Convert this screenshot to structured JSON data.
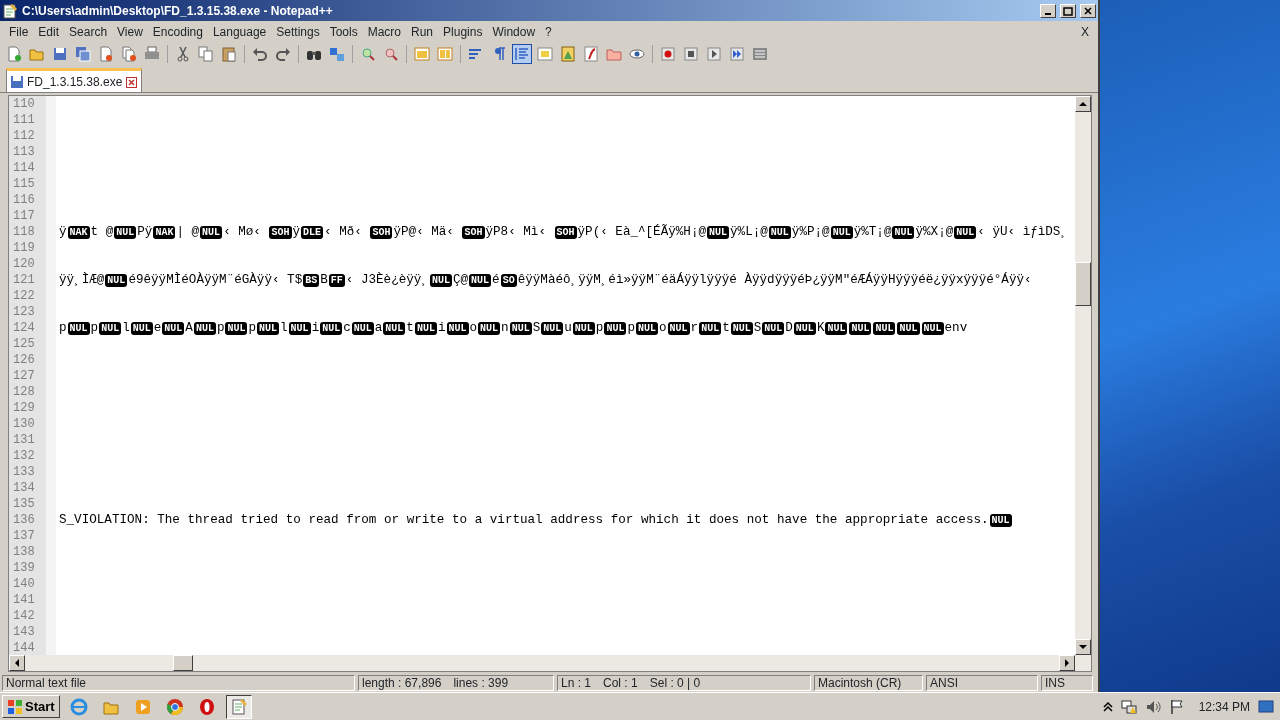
{
  "window": {
    "title": "C:\\Users\\admin\\Desktop\\FD_1.3.15.38.exe - Notepad++",
    "doc_close": "X"
  },
  "menu": [
    "File",
    "Edit",
    "Search",
    "View",
    "Encoding",
    "Language",
    "Settings",
    "Tools",
    "Macro",
    "Run",
    "Plugins",
    "Window",
    "?"
  ],
  "toolbar": [
    [
      {
        "kind": "new",
        "pressed": false
      },
      {
        "kind": "open",
        "pressed": false
      },
      {
        "kind": "save",
        "pressed": false
      },
      {
        "kind": "save-all",
        "pressed": false
      },
      {
        "kind": "close",
        "pressed": false
      },
      {
        "kind": "close-all",
        "pressed": false
      },
      {
        "kind": "print",
        "pressed": false
      }
    ],
    [
      {
        "kind": "cut",
        "pressed": false
      },
      {
        "kind": "copy",
        "pressed": false
      },
      {
        "kind": "paste",
        "pressed": false
      }
    ],
    [
      {
        "kind": "undo",
        "pressed": false
      },
      {
        "kind": "redo",
        "pressed": false
      }
    ],
    [
      {
        "kind": "find",
        "pressed": false
      },
      {
        "kind": "replace",
        "pressed": false
      }
    ],
    [
      {
        "kind": "zoom-in",
        "pressed": false
      },
      {
        "kind": "zoom-out",
        "pressed": false
      }
    ],
    [
      {
        "kind": "sync-v",
        "pressed": false
      },
      {
        "kind": "sync-h",
        "pressed": false
      }
    ],
    [
      {
        "kind": "wrap",
        "pressed": false
      },
      {
        "kind": "pilcrow",
        "pressed": false
      },
      {
        "kind": "indent",
        "pressed": true
      },
      {
        "kind": "lang",
        "pressed": false
      },
      {
        "kind": "docmap",
        "pressed": false
      },
      {
        "kind": "funclist",
        "pressed": false
      },
      {
        "kind": "folder",
        "pressed": false
      },
      {
        "kind": "eye",
        "pressed": false
      }
    ],
    [
      {
        "kind": "record",
        "pressed": false
      },
      {
        "kind": "stop",
        "pressed": false
      },
      {
        "kind": "play",
        "pressed": false
      },
      {
        "kind": "play-multi",
        "pressed": false
      },
      {
        "kind": "save-macro",
        "pressed": false
      }
    ]
  ],
  "tabs": [
    {
      "label": "FD_1.3.15.38.exe",
      "selected": true
    }
  ],
  "editor": {
    "lines": [
      {
        "number": "110"
      },
      {
        "number": "111"
      },
      {
        "number": "112"
      },
      {
        "number": "113"
      },
      {
        "number": "114"
      },
      {
        "number": "115"
      },
      {
        "number": "116"
      },
      {
        "number": "117"
      },
      {
        "number": "118",
        "segments": [
          {
            "kind": "text",
            "text": "ÿ"
          },
          {
            "kind": "ctrl",
            "text": "NAK"
          },
          {
            "kind": "text",
            "text": "t @"
          },
          {
            "kind": "ctrl",
            "text": "NUL"
          },
          {
            "kind": "text",
            "text": "Pÿ"
          },
          {
            "kind": "ctrl",
            "text": "NAK"
          },
          {
            "kind": "text",
            "text": "| @"
          },
          {
            "kind": "ctrl",
            "text": "NUL"
          },
          {
            "kind": "text",
            "text": "‹ Mø‹ "
          },
          {
            "kind": "ctrl",
            "text": "SOH"
          },
          {
            "kind": "text",
            "text": "ÿ"
          },
          {
            "kind": "ctrl",
            "text": "DLE"
          },
          {
            "kind": "text",
            "text": "‹ Mð‹ "
          },
          {
            "kind": "ctrl",
            "text": "SOH"
          },
          {
            "kind": "text",
            "text": "ÿP@‹ Mä‹ "
          },
          {
            "kind": "ctrl",
            "text": "SOH"
          },
          {
            "kind": "text",
            "text": "ÿP8‹ Mì‹ "
          },
          {
            "kind": "ctrl",
            "text": "SOH"
          },
          {
            "kind": "text",
            "text": "ÿP(‹ Eà_^[ÉÃÿ%H¡@"
          },
          {
            "kind": "ctrl",
            "text": "NUL"
          },
          {
            "kind": "text",
            "text": "ÿ%L¡@"
          },
          {
            "kind": "ctrl",
            "text": "NUL"
          },
          {
            "kind": "text",
            "text": "ÿ%P¡@"
          },
          {
            "kind": "ctrl",
            "text": "NUL"
          },
          {
            "kind": "text",
            "text": "ÿ%T¡@"
          },
          {
            "kind": "ctrl",
            "text": "NUL"
          },
          {
            "kind": "text",
            "text": "ÿ%X¡@"
          },
          {
            "kind": "ctrl",
            "text": "NUL"
          },
          {
            "kind": "text",
            "text": "‹ ÿU‹ ìƒìDS¸"
          }
        ]
      },
      {
        "number": "119"
      },
      {
        "number": "120"
      },
      {
        "number": "121",
        "segments": [
          {
            "kind": "text",
            "text": "ÿÿ¸ÌÆ@"
          },
          {
            "kind": "ctrl",
            "text": "NUL"
          },
          {
            "kind": "text",
            "text": "é9êÿÿMÌéOÀÿÿM¨éGÀÿÿ‹ T$"
          },
          {
            "kind": "ctrl",
            "text": "BS"
          },
          {
            "kind": "text",
            "text": "B"
          },
          {
            "kind": "ctrl",
            "text": "FF"
          },
          {
            "kind": "text",
            "text": "‹ J3Èè¿èÿÿ¸"
          },
          {
            "kind": "ctrl",
            "text": "NUL"
          },
          {
            "kind": "text",
            "text": "Ç@"
          },
          {
            "kind": "ctrl",
            "text": "NUL"
          },
          {
            "kind": "text",
            "text": "é"
          },
          {
            "kind": "ctrl",
            "text": "SO"
          },
          {
            "kind": "text",
            "text": "êÿÿMàéô¸ÿÿM¸éì»ÿÿM¨éäÁÿÿlÿÿÿé ÀÿÿdÿÿÿéÞ¿ÿÿM″éÆÁÿÿHÿÿÿéë¿ÿÿxÿÿÿé°Áÿÿ‹"
          }
        ]
      },
      {
        "number": "122"
      },
      {
        "number": "123"
      },
      {
        "number": "124",
        "segments": [
          {
            "kind": "text",
            "text": "p"
          },
          {
            "kind": "ctrl",
            "text": "NUL"
          },
          {
            "kind": "text",
            "text": "p"
          },
          {
            "kind": "ctrl",
            "text": "NUL"
          },
          {
            "kind": "text",
            "text": "l"
          },
          {
            "kind": "ctrl",
            "text": "NUL"
          },
          {
            "kind": "text",
            "text": "e"
          },
          {
            "kind": "ctrl",
            "text": "NUL"
          },
          {
            "kind": "text",
            "text": "A"
          },
          {
            "kind": "ctrl",
            "text": "NUL"
          },
          {
            "kind": "text",
            "text": "p"
          },
          {
            "kind": "ctrl",
            "text": "NUL"
          },
          {
            "kind": "text",
            "text": "p"
          },
          {
            "kind": "ctrl",
            "text": "NUL"
          },
          {
            "kind": "text",
            "text": "l"
          },
          {
            "kind": "ctrl",
            "text": "NUL"
          },
          {
            "kind": "text",
            "text": "i"
          },
          {
            "kind": "ctrl",
            "text": "NUL"
          },
          {
            "kind": "text",
            "text": "c"
          },
          {
            "kind": "ctrl",
            "text": "NUL"
          },
          {
            "kind": "text",
            "text": "a"
          },
          {
            "kind": "ctrl",
            "text": "NUL"
          },
          {
            "kind": "text",
            "text": "t"
          },
          {
            "kind": "ctrl",
            "text": "NUL"
          },
          {
            "kind": "text",
            "text": "i"
          },
          {
            "kind": "ctrl",
            "text": "NUL"
          },
          {
            "kind": "text",
            "text": "o"
          },
          {
            "kind": "ctrl",
            "text": "NUL"
          },
          {
            "kind": "text",
            "text": "n"
          },
          {
            "kind": "ctrl",
            "text": "NUL"
          },
          {
            "kind": "text",
            "text": "S"
          },
          {
            "kind": "ctrl",
            "text": "NUL"
          },
          {
            "kind": "text",
            "text": "u"
          },
          {
            "kind": "ctrl",
            "text": "NUL"
          },
          {
            "kind": "text",
            "text": "p"
          },
          {
            "kind": "ctrl",
            "text": "NUL"
          },
          {
            "kind": "text",
            "text": "p"
          },
          {
            "kind": "ctrl",
            "text": "NUL"
          },
          {
            "kind": "text",
            "text": "o"
          },
          {
            "kind": "ctrl",
            "text": "NUL"
          },
          {
            "kind": "text",
            "text": "r"
          },
          {
            "kind": "ctrl",
            "text": "NUL"
          },
          {
            "kind": "text",
            "text": "t"
          },
          {
            "kind": "ctrl",
            "text": "NUL"
          },
          {
            "kind": "text",
            "text": "S"
          },
          {
            "kind": "ctrl",
            "text": "NUL"
          },
          {
            "kind": "text",
            "text": "D"
          },
          {
            "kind": "ctrl",
            "text": "NUL"
          },
          {
            "kind": "text",
            "text": "K"
          },
          {
            "kind": "ctrl",
            "text": "NUL"
          },
          {
            "kind": "ctrl",
            "text": "NUL"
          },
          {
            "kind": "ctrl",
            "text": "NUL"
          },
          {
            "kind": "ctrl",
            "text": "NUL"
          },
          {
            "kind": "ctrl",
            "text": "NUL"
          },
          {
            "kind": "text",
            "text": "env"
          }
        ]
      },
      {
        "number": "125"
      },
      {
        "number": "126"
      },
      {
        "number": "127"
      },
      {
        "number": "128"
      },
      {
        "number": "129"
      },
      {
        "number": "130"
      },
      {
        "number": "131"
      },
      {
        "number": "132"
      },
      {
        "number": "133"
      },
      {
        "number": "134"
      },
      {
        "number": "135"
      },
      {
        "number": "136",
        "segments": [
          {
            "kind": "text",
            "text": "S_VIOLATION: The thread tried to read from or write to a virtual address for which it does not have the appropriate access."
          },
          {
            "kind": "ctrl",
            "text": "NUL"
          }
        ]
      },
      {
        "number": "137"
      },
      {
        "number": "138"
      },
      {
        "number": "139"
      },
      {
        "number": "140"
      },
      {
        "number": "141"
      },
      {
        "number": "142"
      },
      {
        "number": "143"
      },
      {
        "number": "144"
      }
    ]
  },
  "status_bar": [
    [
      "Normal text file"
    ],
    [
      "length : 67,896",
      "lines : 399"
    ],
    [
      "Ln : 1",
      "Col : 1",
      "Sel : 0 | 0"
    ],
    [
      "Macintosh (CR)"
    ],
    [
      "ANSI"
    ],
    [
      "INS"
    ]
  ],
  "taskbar": {
    "start": "Start",
    "apps": [
      {
        "kind": "ie",
        "active": false
      },
      {
        "kind": "folder",
        "active": false
      },
      {
        "kind": "media",
        "active": false
      },
      {
        "kind": "chrome",
        "active": false
      },
      {
        "kind": "opera",
        "active": false
      },
      {
        "kind": "notepad",
        "active": true
      }
    ],
    "clock": "12:34 PM"
  }
}
